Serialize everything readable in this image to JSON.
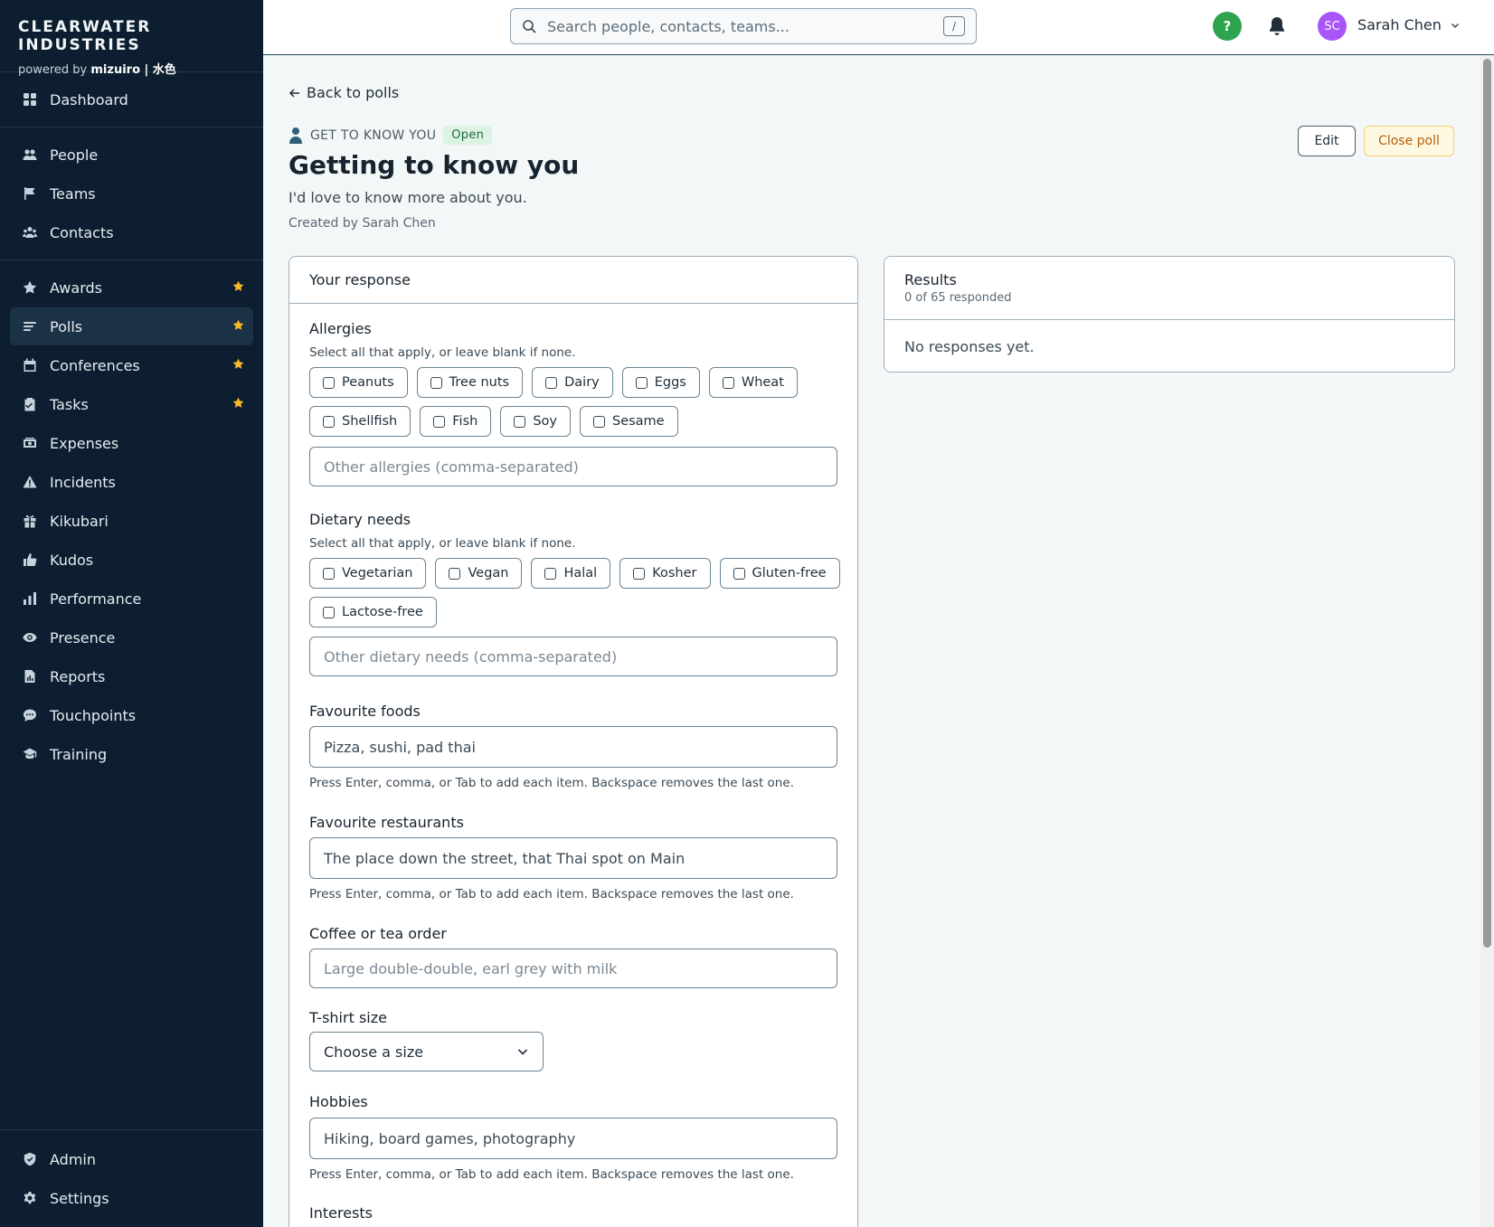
{
  "brand": {
    "name": "CLEARWATER INDUSTRIES",
    "powered_prefix": "powered by",
    "powered_name": "mizuiro | 水色"
  },
  "sidebar": {
    "top": [
      {
        "label": "Dashboard",
        "icon": "grid-icon"
      }
    ],
    "group1": [
      {
        "label": "People",
        "icon": "people-icon"
      },
      {
        "label": "Teams",
        "icon": "flag-icon"
      },
      {
        "label": "Contacts",
        "icon": "contacts-icon"
      }
    ],
    "group2": [
      {
        "label": "Awards",
        "icon": "star-icon",
        "starred": true
      },
      {
        "label": "Polls",
        "icon": "list-icon",
        "starred": true,
        "active": true
      },
      {
        "label": "Conferences",
        "icon": "calendar-icon",
        "starred": true
      },
      {
        "label": "Tasks",
        "icon": "clipboard-check-icon",
        "starred": true
      },
      {
        "label": "Expenses",
        "icon": "wallet-icon"
      },
      {
        "label": "Incidents",
        "icon": "warning-icon"
      },
      {
        "label": "Kikubari",
        "icon": "gift-icon"
      },
      {
        "label": "Kudos",
        "icon": "thumbs-up-icon"
      },
      {
        "label": "Performance",
        "icon": "bar-chart-icon"
      },
      {
        "label": "Presence",
        "icon": "eye-icon"
      },
      {
        "label": "Reports",
        "icon": "report-icon"
      },
      {
        "label": "Touchpoints",
        "icon": "chat-icon"
      },
      {
        "label": "Training",
        "icon": "graduation-cap-icon"
      }
    ],
    "bottom": [
      {
        "label": "Admin",
        "icon": "shield-icon"
      },
      {
        "label": "Settings",
        "icon": "gear-icon"
      }
    ],
    "star_color": "#f7b928"
  },
  "topbar": {
    "search_placeholder": "Search people, contacts, teams...",
    "search_shortcut": "/",
    "help_label": "?",
    "user_initials": "SC",
    "user_name": "Sarah Chen",
    "avatar_color": "#a855f7"
  },
  "page": {
    "back_label": "Back to polls",
    "kicker": "GET TO KNOW YOU",
    "status": "Open",
    "title": "Getting to know you",
    "description": "I'd love to know more about you.",
    "created_by": "Created by Sarah Chen",
    "edit_label": "Edit",
    "close_label": "Close poll"
  },
  "response": {
    "title": "Your response",
    "allergies": {
      "label": "Allergies",
      "hint": "Select all that apply, or leave blank if none.",
      "row1": [
        "Peanuts",
        "Tree nuts",
        "Dairy",
        "Eggs",
        "Wheat"
      ],
      "row2": [
        "Shellfish",
        "Fish",
        "Soy",
        "Sesame"
      ],
      "other_placeholder": "Other allergies (comma-separated)"
    },
    "dietary": {
      "label": "Dietary needs",
      "hint": "Select all that apply, or leave blank if none.",
      "row1": [
        "Vegetarian",
        "Vegan",
        "Halal",
        "Kosher",
        "Gluten-free"
      ],
      "row2": [
        "Lactose-free"
      ],
      "other_placeholder": "Other dietary needs (comma-separated)"
    },
    "foods": {
      "label": "Favourite foods",
      "placeholder": "Pizza, sushi, pad thai",
      "help": "Press Enter, comma, or Tab to add each item. Backspace removes the last one."
    },
    "restaurants": {
      "label": "Favourite restaurants",
      "placeholder": "The place down the street, that Thai spot on Main",
      "help": "Press Enter, comma, or Tab to add each item. Backspace removes the last one."
    },
    "coffee": {
      "label": "Coffee or tea order",
      "placeholder": "Large double-double, earl grey with milk"
    },
    "tshirt": {
      "label": "T-shirt size",
      "value": "Choose a size"
    },
    "hobbies": {
      "label": "Hobbies",
      "placeholder": "Hiking, board games, photography",
      "help": "Press Enter, comma, or Tab to add each item. Backspace removes the last one."
    },
    "interests": {
      "label": "Interests"
    }
  },
  "results": {
    "title": "Results",
    "subtitle": "0 of 65 responded",
    "empty": "No responses yet."
  }
}
